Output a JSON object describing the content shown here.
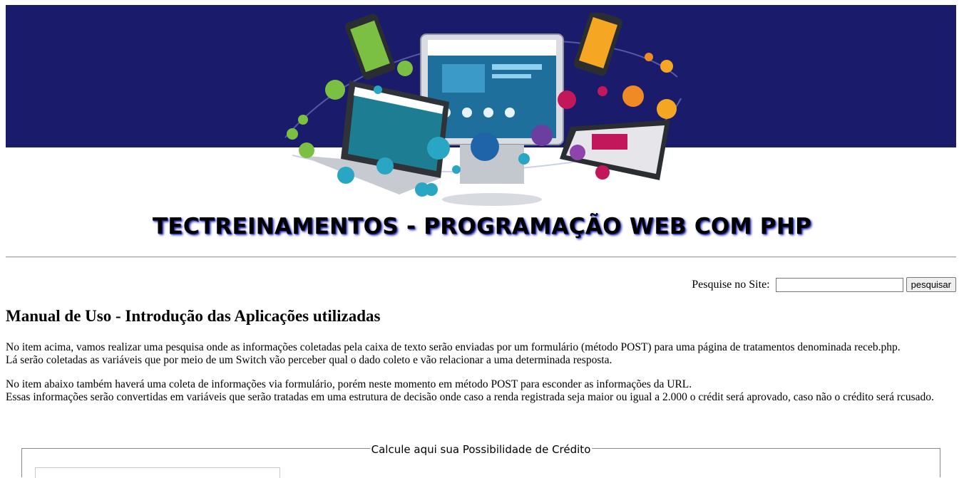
{
  "header": {
    "site_title": "TECTREINAMENTOS - PROGRAMAÇÃO WEB COM PHP",
    "banner_color": "#1b1b6c"
  },
  "search": {
    "label": "Pesquise no Site:",
    "placeholder": "",
    "value": "",
    "button_label": "pesquisar"
  },
  "content": {
    "heading": "Manual de Uso - Introdução das Aplicações utilizadas",
    "paragraph1_line1": "No item acima, vamos realizar uma pesquisa onde as informações coletadas pela caixa de texto serão enviadas por um formulário (método POST) para uma página de tratamentos denominada receb.php.",
    "paragraph1_line2": "Lá serão coletadas as variáveis que por meio de um Switch vão perceber qual o dado coleto e vão relacionar a uma determinada resposta.",
    "paragraph2_line1": "No item abaixo também haverá uma coleta de informações via formulário, porém neste momento em método POST para esconder as informações da URL.",
    "paragraph2_line2": "Essas informações serão convertidas em variáveis que serão tratadas em uma estrutura de decisão onde caso a renda registrada seja maior ou igual a 2.000 o crédit será aprovado, caso não o crédito será rcusado."
  },
  "credit_form": {
    "legend": "Calcule aqui sua Possibilidade de Crédito"
  }
}
